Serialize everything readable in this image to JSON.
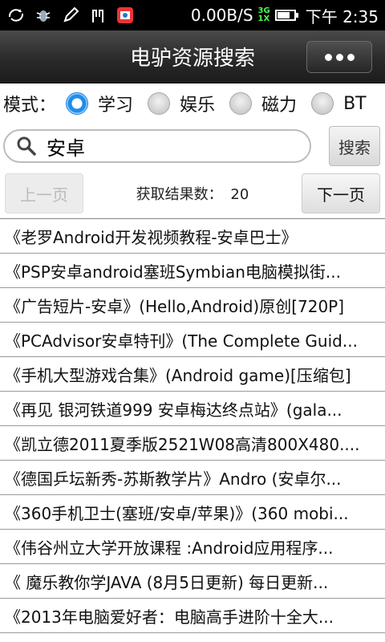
{
  "status_bar": {
    "net_speed": "0.00B/S",
    "signal_top": "3G",
    "signal_bottom": "1X",
    "time": "下午 2:35"
  },
  "header": {
    "title": "电驴资源搜索"
  },
  "mode": {
    "label": "模式：",
    "options": [
      {
        "label": "学习",
        "checked": true
      },
      {
        "label": "娱乐",
        "checked": false
      },
      {
        "label": "磁力",
        "checked": false
      },
      {
        "label": "BT",
        "checked": false
      }
    ]
  },
  "search": {
    "value": "安卓",
    "button_label": "搜索"
  },
  "pager": {
    "prev_label": "上一页",
    "next_label": "下一页",
    "count_label": "获取结果数：",
    "count_value": "20"
  },
  "results": [
    "《老罗Android开发视频教程-安卓巴士》",
    "《PSP安卓android塞班Symbian电脑模拟街...",
    "《广告短片-安卓》(Hello,Android)原创[720P]",
    "《PCAdvisor安卓特刊》(The Complete Guid...",
    "《手机大型游戏合集》(Android game)[压缩包]",
    "《再见 银河铁道999 安卓梅达终点站》(gala...",
    "《凯立德2011夏季版2521W08高清800X480....",
    "《德国乒坛新秀-苏斯教学片》Andro (安卓尔...",
    "《360手机卫士(塞班/安卓/苹果)》(360 mobi...",
    "《伟谷州立大学开放课程 :Android应用程序...",
    "《 魔乐教你学JAVA (8月5日更新) 每日更新...",
    "《2013年电脑爱好者：电脑高手进阶十全大..."
  ]
}
